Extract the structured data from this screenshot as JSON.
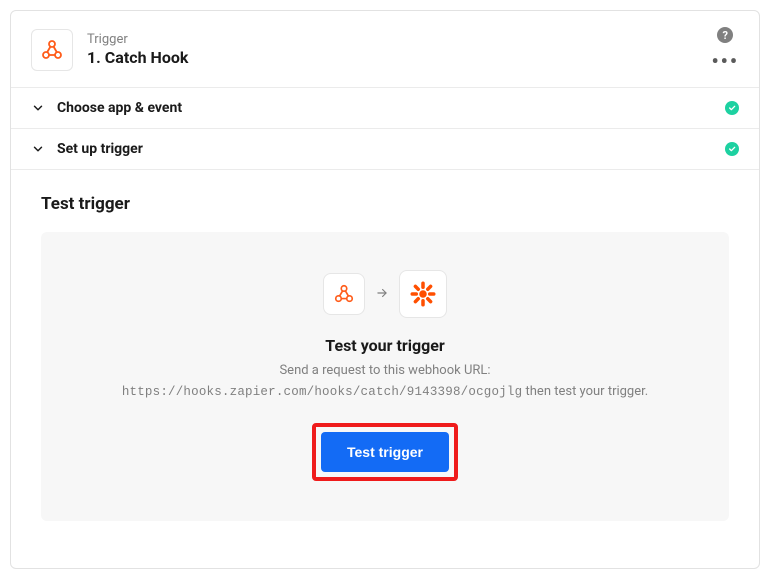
{
  "header": {
    "trigger_label": "Trigger",
    "step_title": "1. Catch Hook"
  },
  "sections": {
    "choose_label": "Choose app & event",
    "setup_label": "Set up trigger"
  },
  "test": {
    "heading": "Test trigger",
    "title": "Test your trigger",
    "subtitle": "Send a request to this webhook URL:",
    "url": "https://hooks.zapier.com/hooks/catch/9143398/ocgojlg",
    "url_suffix": " then test your trigger.",
    "button_label": "Test trigger"
  },
  "icons": {
    "help": "?",
    "more": "•••"
  }
}
